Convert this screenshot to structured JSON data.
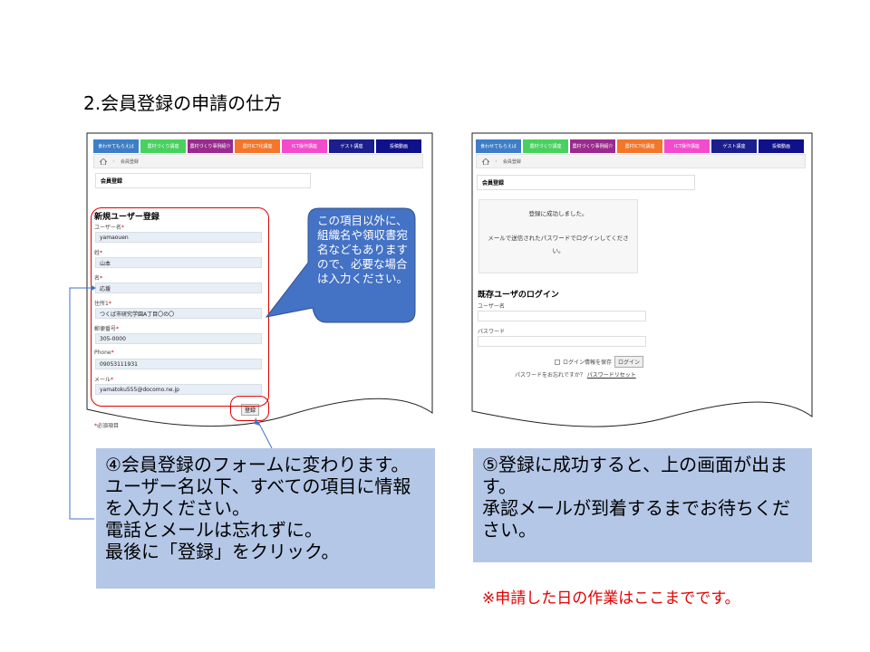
{
  "slide_title": "2.会員登録の申請の仕方",
  "nav_items": [
    {
      "label": "食わせてもらえば",
      "color": "#3d7ec6"
    },
    {
      "label": "農村づくり講座",
      "color": "#49d160"
    },
    {
      "label": "農村づくり事例紹介",
      "color": "#9a2a8e"
    },
    {
      "label": "農村ICT化講座",
      "color": "#f3762b"
    },
    {
      "label": "ICT操作講座",
      "color": "#f24bcb"
    },
    {
      "label": "ゲスト講座",
      "color": "#1b1e8c"
    },
    {
      "label": "投稿動画",
      "color": "#10108a"
    }
  ],
  "left_screen": {
    "breadcrumb": "会員登録",
    "panel_title": "会員登録",
    "form_heading": "新規ユーザー登録",
    "fields": [
      {
        "label": "ユーザー名",
        "value": "yamaouen"
      },
      {
        "label": "姓",
        "value": "山本"
      },
      {
        "label": "名",
        "value": "応援"
      },
      {
        "label": "住所1",
        "value": "つくば市研究学園A丁目〇の〇"
      },
      {
        "label": "郵便番号",
        "value": "305-0000"
      },
      {
        "label": "Phone",
        "value": "09053111931"
      },
      {
        "label": "メール",
        "value": "yamatoku555@docomo.ne.jp"
      }
    ],
    "required_mark": "*",
    "submit_label": "登録",
    "required_note": "必須項目"
  },
  "callout": "この項目以外に、組織名や領収書宛名などもありますので、必要な場合は入力ください。",
  "right_screen": {
    "breadcrumb": "会員登録",
    "panel_title": "会員登録",
    "success_line1": "登録に成功しました。",
    "success_line2": "メールで送信されたパスワードでログインしてください。",
    "login_heading": "既存ユーザのログイン",
    "username_label": "ユーザー名",
    "password_label": "パスワード",
    "remember_label": "ログイン情報を保存",
    "login_button": "ログイン",
    "forgot_text": "パスワードをお忘れですか？",
    "reset_link": "パスワードリセット"
  },
  "caption_left": "④会員登録のフォームに変わります。ユーザー名以下、すべての項目に情報を入力ください。\n電話とメールは忘れずに。\n最後に「登録」をクリック。",
  "caption_right": "⑤登録に成功すると、上の画面が出ます。\n承認メールが到着するまでお待ちください。",
  "note": "※申請した日の作業はここまでです。"
}
